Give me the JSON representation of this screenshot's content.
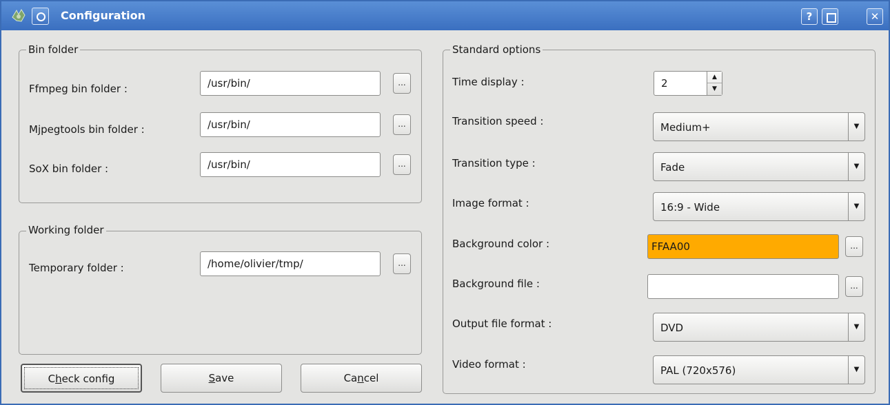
{
  "window": {
    "title": "Configuration",
    "help_button": "?",
    "close_button": "✕"
  },
  "bin_folder": {
    "group_label": "Bin folder",
    "ffmpeg_label": "Ffmpeg bin folder :",
    "ffmpeg_value": "/usr/bin/",
    "mjpegtools_label": "Mjpegtools bin folder :",
    "mjpegtools_value": "/usr/bin/",
    "sox_label": "SoX bin folder :",
    "sox_value": "/usr/bin/",
    "browse_label": "..."
  },
  "working_folder": {
    "group_label": "Working folder",
    "temporary_label": "Temporary folder :",
    "temporary_value": "/home/olivier/tmp/"
  },
  "standard_options": {
    "group_label": "Standard options",
    "time_display_label": "Time display :",
    "time_display_value": "2",
    "transition_speed_label": "Transition speed :",
    "transition_speed_value": "Medium+",
    "transition_type_label": "Transition type :",
    "transition_type_value": "Fade",
    "image_format_label": "Image format :",
    "image_format_value": "16:9 - Wide",
    "background_color_label": "Background color :",
    "background_color_value": "FFAA00",
    "background_color_hex": "#ffaa00",
    "background_file_label": "Background file :",
    "background_file_value": "",
    "output_file_format_label": "Output file format :",
    "output_file_format_value": "DVD",
    "video_format_label": "Video format :",
    "video_format_value": "PAL (720x576)"
  },
  "buttons": {
    "check_config": {
      "before": "C",
      "key": "h",
      "after": "eck config"
    },
    "save": {
      "before": "",
      "key": "S",
      "after": "ave"
    },
    "cancel": {
      "before": "Ca",
      "key": "n",
      "after": "cel"
    }
  },
  "icons": {
    "app": "app-logo-icon",
    "menu": "window-menu-icon",
    "browse": "ellipsis-icon",
    "combo": "chevron-down-icon",
    "spin_up": "arrow-up-icon",
    "spin_down": "arrow-down-icon",
    "maximize": "maximize-icon"
  }
}
